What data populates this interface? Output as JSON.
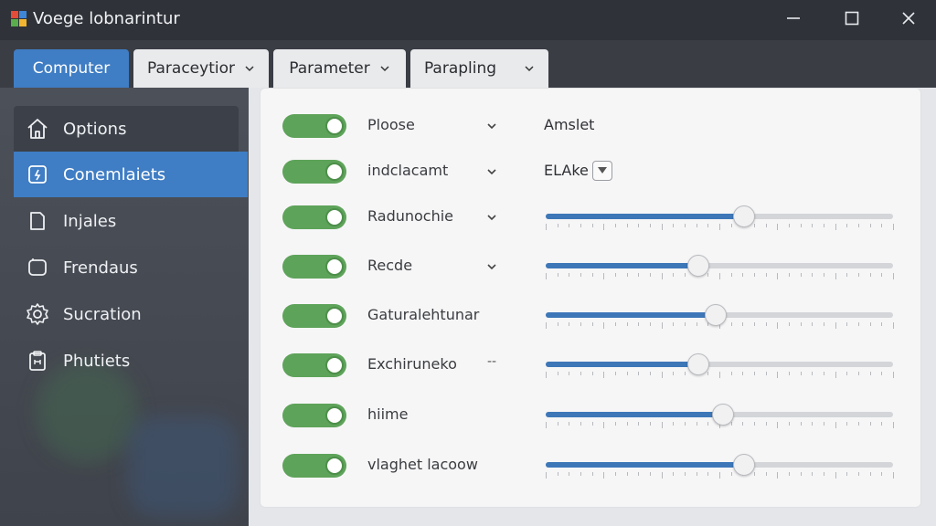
{
  "window": {
    "title": "Voege lobnarintur",
    "controls": [
      "minimize-icon",
      "maximize-icon",
      "close-icon"
    ]
  },
  "tabs": [
    {
      "label": "Computer",
      "active": true,
      "has_dropdown": false
    },
    {
      "label": "Paraceytior",
      "active": false,
      "has_dropdown": true
    },
    {
      "label": "Parameter",
      "active": false,
      "has_dropdown": true
    },
    {
      "label": "Parapling",
      "active": false,
      "has_dropdown": true
    }
  ],
  "sidebar": {
    "items": [
      {
        "label": "Options",
        "icon": "home-icon",
        "selected": false
      },
      {
        "label": "Conemlaiets",
        "icon": "edit-icon",
        "selected": true
      },
      {
        "label": "Injales",
        "icon": "document-icon",
        "selected": false
      },
      {
        "label": "Frendaus",
        "icon": "window-icon",
        "selected": false
      },
      {
        "label": "Sucration",
        "icon": "gear-icon",
        "selected": false
      },
      {
        "label": "Phutiets",
        "icon": "clipboard-icon",
        "selected": false
      }
    ]
  },
  "settings": [
    {
      "label": "Ploose",
      "enabled": true,
      "control": "text",
      "chevron": true,
      "value": "Amslet"
    },
    {
      "label": "indclacamt",
      "enabled": true,
      "control": "dropdown",
      "chevron": true,
      "value": "ELAke"
    },
    {
      "label": "Radunochie",
      "enabled": true,
      "control": "slider",
      "chevron": true,
      "level": 0.57
    },
    {
      "label": "Recde",
      "enabled": true,
      "control": "slider",
      "chevron": true,
      "level": 0.44
    },
    {
      "label": "Gaturalehtunar",
      "enabled": true,
      "control": "slider",
      "chevron": false,
      "level": 0.49
    },
    {
      "label": "Exchiruneko",
      "enabled": true,
      "control": "slider",
      "dash": "--",
      "level": 0.44
    },
    {
      "label": "hiime",
      "enabled": true,
      "control": "slider",
      "chevron": false,
      "level": 0.51
    },
    {
      "label": "vlaghet lacoow",
      "enabled": true,
      "control": "slider",
      "chevron": false,
      "level": 0.57
    }
  ],
  "colors": {
    "accent": "#3f7dc4",
    "toggle_on": "#5ea35a",
    "slider_fill": "#3d77b8",
    "titlebar": "#2f3238"
  }
}
